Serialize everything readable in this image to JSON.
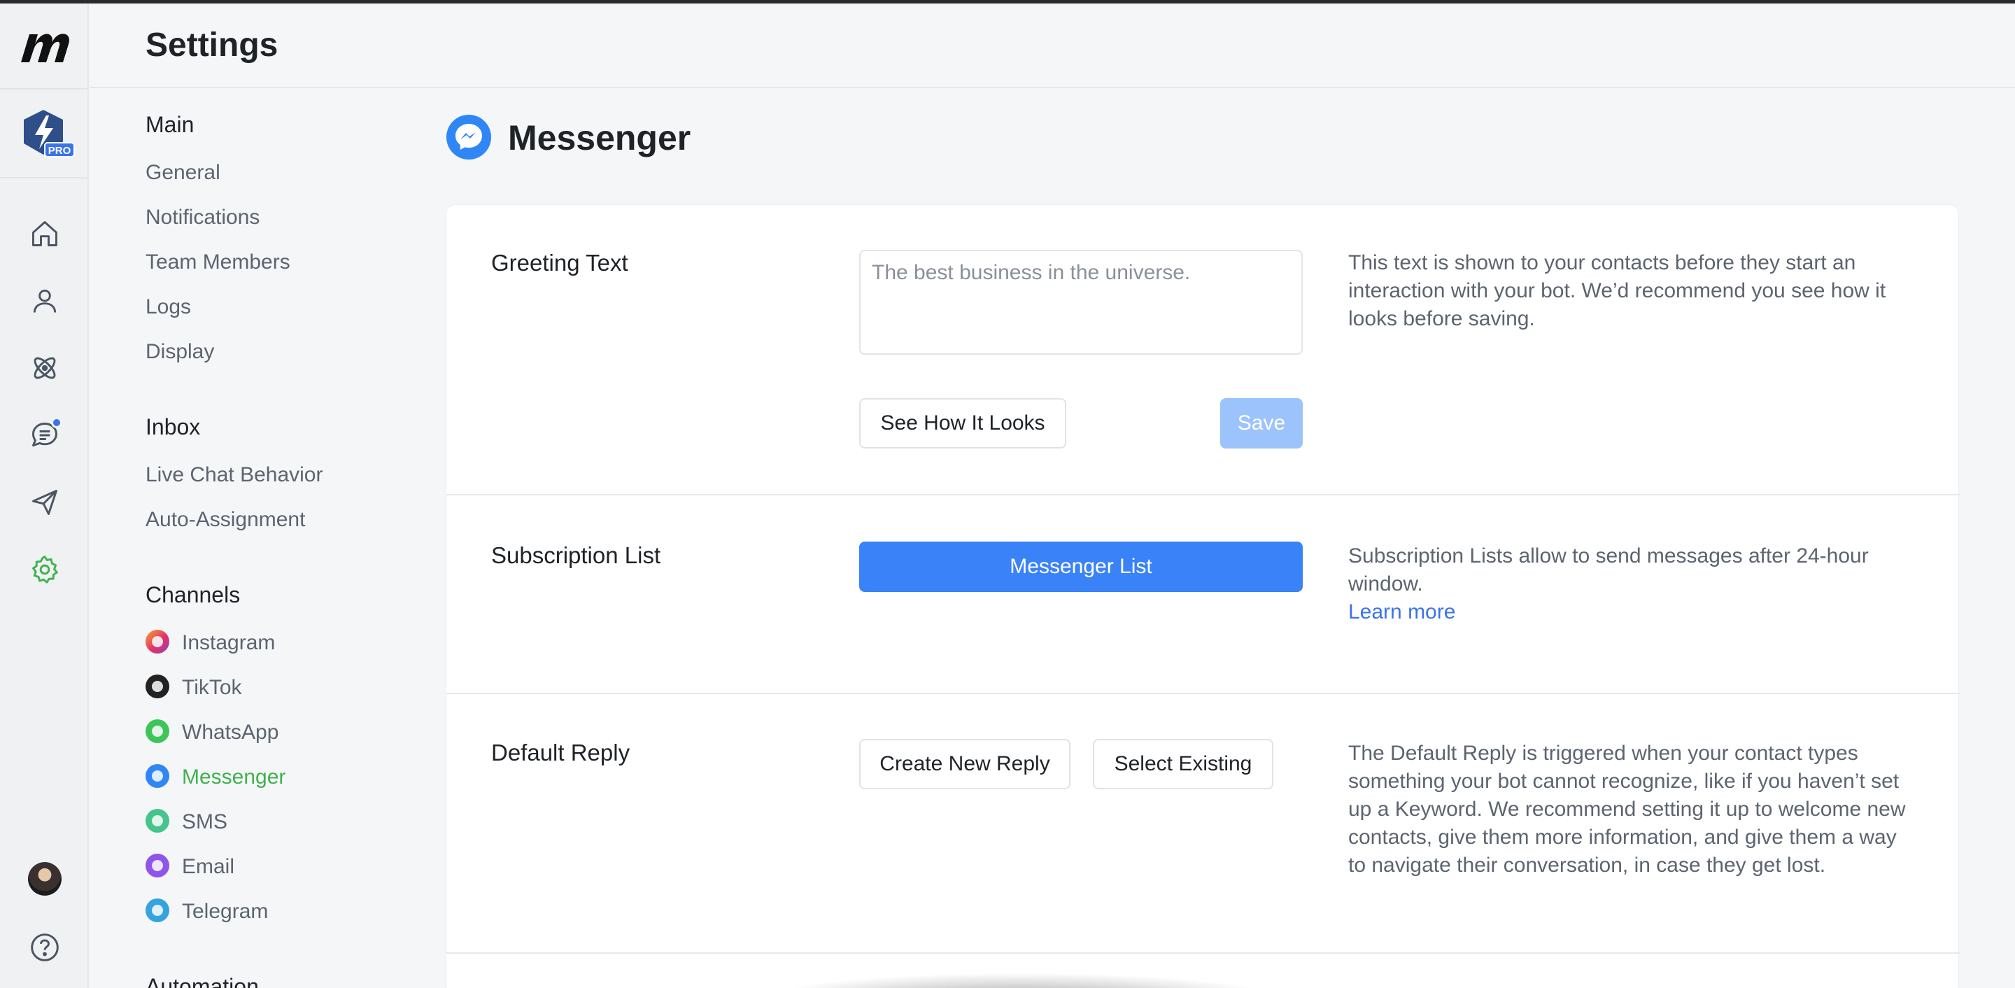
{
  "app": {
    "page_title": "Settings",
    "brand_icon": "m-logo",
    "pro_badge": "PRO"
  },
  "rail": {
    "icons": [
      "home-icon",
      "contacts-icon",
      "automation-icon",
      "live-chat-icon",
      "broadcast-icon",
      "settings-icon",
      "help-icon"
    ],
    "active": "settings-icon",
    "accent": "#3fb24e",
    "notification_color": "#3a74e8"
  },
  "nav": {
    "groups": [
      {
        "title": "Main",
        "items": [
          "General",
          "Notifications",
          "Team Members",
          "Logs",
          "Display"
        ]
      },
      {
        "title": "Inbox",
        "items": [
          "Live Chat Behavior",
          "Auto-Assignment"
        ]
      },
      {
        "title": "Channels",
        "items": [
          "Instagram",
          "TikTok",
          "WhatsApp",
          "Messenger",
          "SMS",
          "Email",
          "Telegram"
        ]
      },
      {
        "title": "Automation"
      }
    ],
    "active_item": "Messenger",
    "channel_colors": {
      "Instagram": "#e1306c",
      "TikTok": "#222222",
      "WhatsApp": "#3ec55a",
      "Messenger": "#2f86f6",
      "SMS": "#45c48b",
      "Email": "#8e55e8",
      "Telegram": "#35a3e0"
    }
  },
  "main": {
    "title": "Messenger",
    "greeting": {
      "label": "Greeting Text",
      "placeholder": "The best business in the universe.",
      "value": "",
      "preview_button": "See How It Looks",
      "save_button": "Save",
      "help": "This text is shown to your contacts before they start an interaction with your bot. We’d recommend you see how it looks before saving."
    },
    "subscription": {
      "label": "Subscription List",
      "button": "Messenger List",
      "help": "Subscription Lists allow to send messages after 24-hour window.",
      "link": "Learn more"
    },
    "default_reply": {
      "label": "Default Reply",
      "create_button": "Create New Reply",
      "select_button": "Select Existing",
      "help": "The Default Reply is triggered when your contact types something your bot cannot recognize, like if you haven’t set up a Keyword. We recommend setting it up to welcome new contacts, give them more information, and give them a way to navigate their conversation, in case they get lost."
    }
  }
}
